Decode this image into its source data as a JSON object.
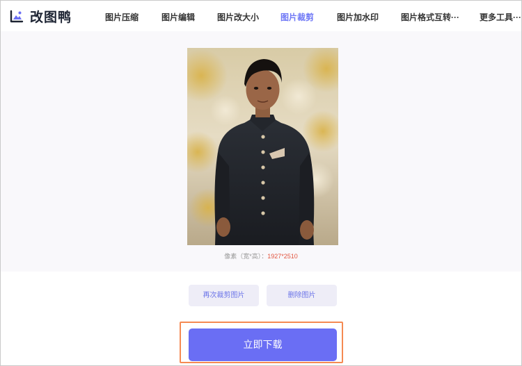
{
  "app": {
    "logo_text": "改图鸭"
  },
  "nav": {
    "items": [
      {
        "label": "图片压缩"
      },
      {
        "label": "图片编辑"
      },
      {
        "label": "图片改大小"
      },
      {
        "label": "图片裁剪",
        "active": true
      },
      {
        "label": "图片加水印"
      },
      {
        "label": "图片格式互转···"
      },
      {
        "label": "更多工具···"
      }
    ]
  },
  "preview": {
    "image_alt": "boy in black suit portrait",
    "dims_label": "像素（宽*高）：",
    "dims_value": "1927*2510"
  },
  "actions": {
    "recrop_label": "再次裁剪图片",
    "delete_label": "删除图片",
    "download_label": "立即下载"
  },
  "colors": {
    "accent": "#6a6ef4",
    "nav_active": "#6f78f6",
    "highlight": "#f58a52",
    "dims_value": "#e2553f"
  }
}
